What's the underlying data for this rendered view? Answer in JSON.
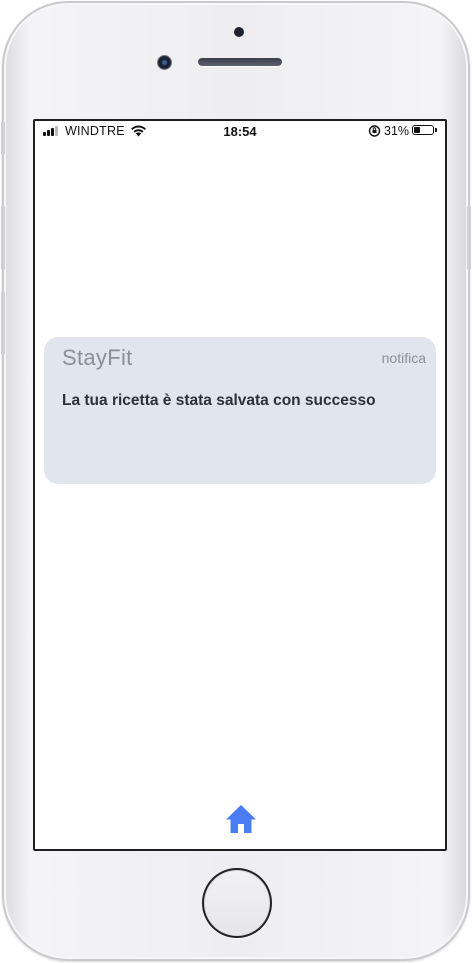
{
  "status_bar": {
    "carrier": "WINDTRE",
    "time": "18:54",
    "battery_percent_label": "31%",
    "battery_level": 0.31
  },
  "notification": {
    "app_name": "StayFit",
    "tag": "notifica",
    "message": "La tua ricetta è stata salvata con successo"
  },
  "tab_bar": {
    "home_icon": "home-icon",
    "accent_color": "#4a7cf3"
  },
  "colors": {
    "notification_bg": "#e1e5ed",
    "muted_text": "#8a8f99",
    "message_text": "#2d3139"
  }
}
